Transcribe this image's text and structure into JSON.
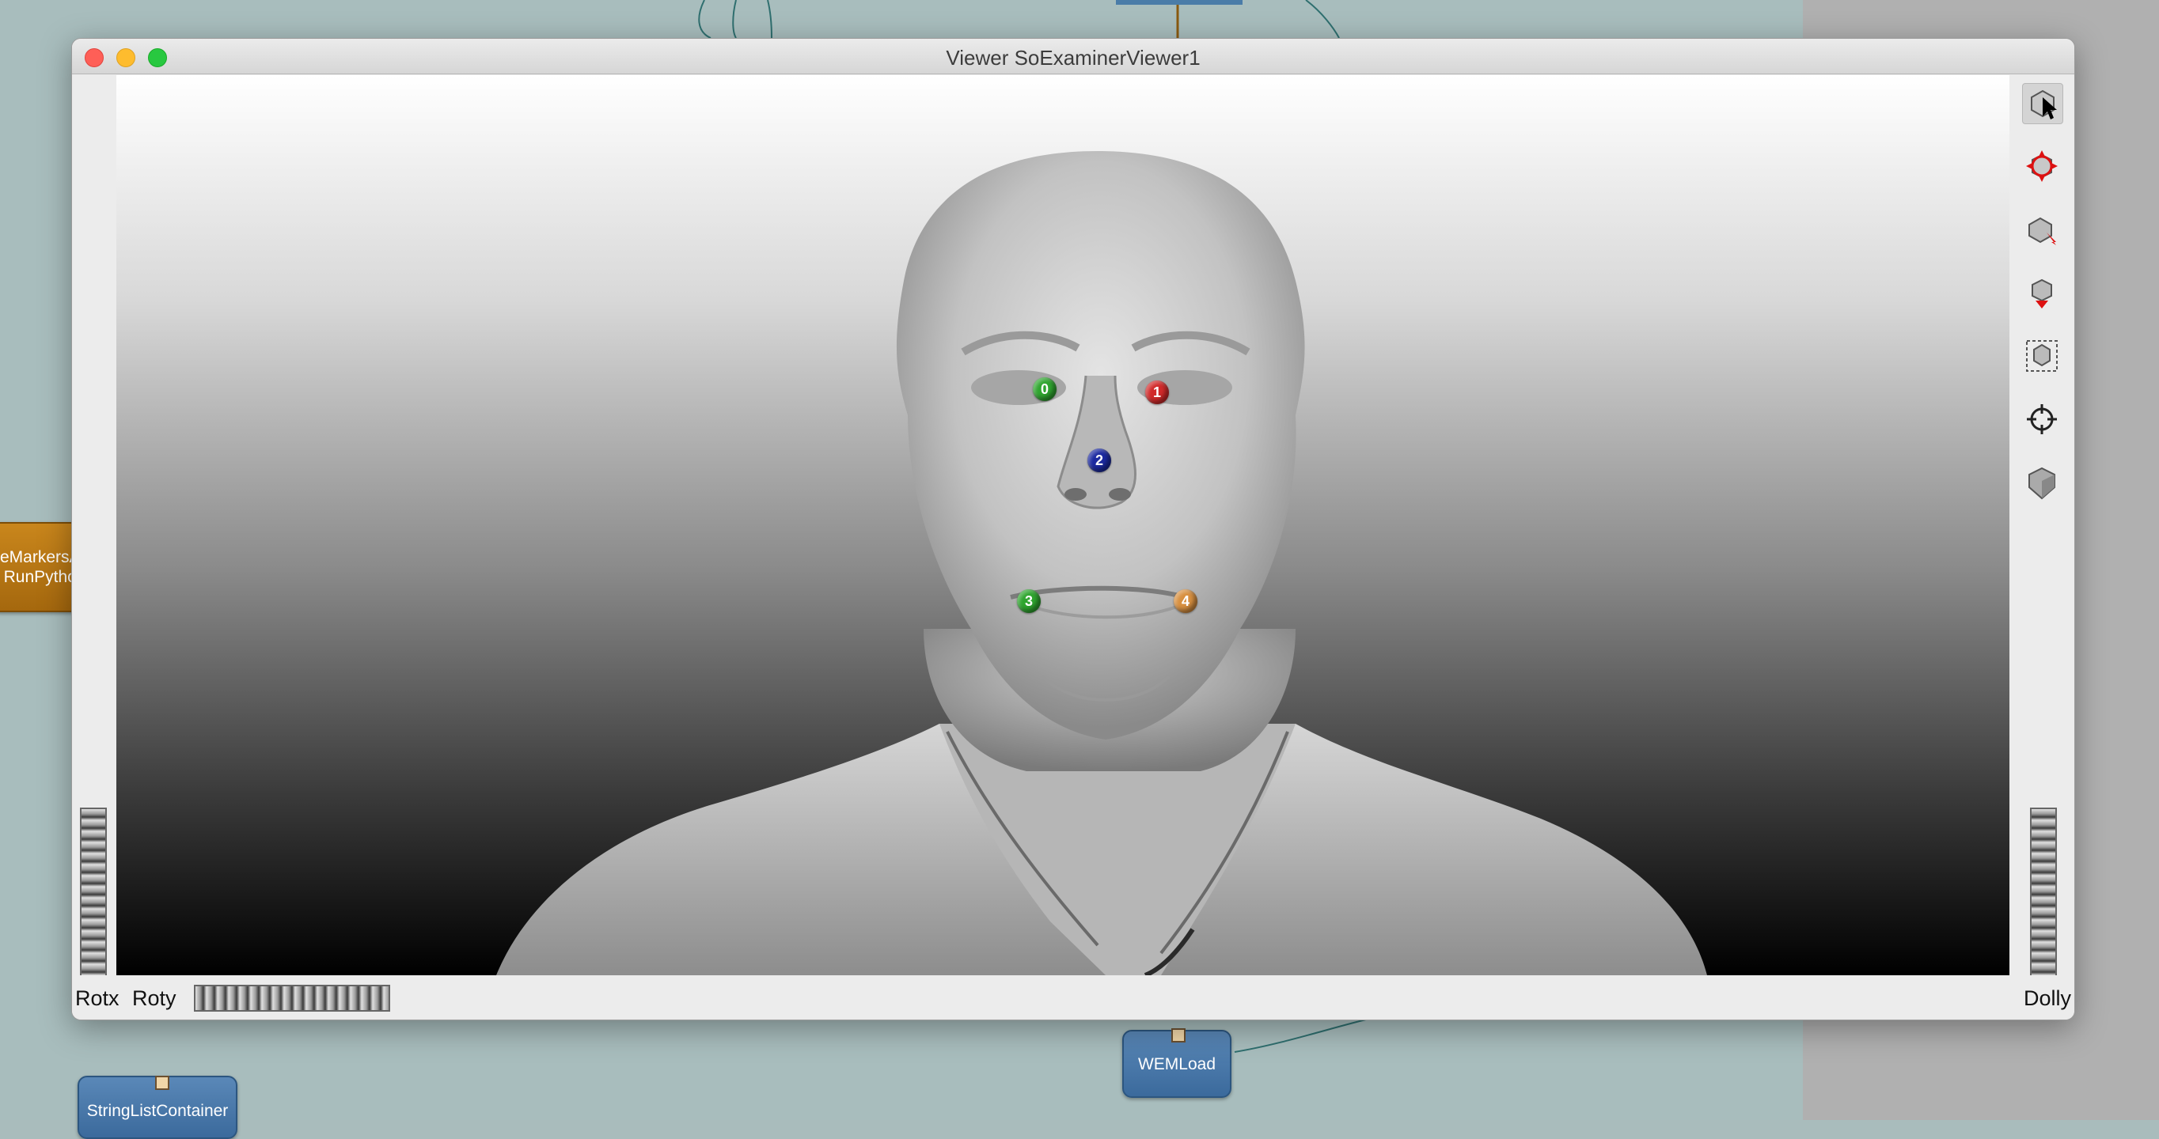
{
  "window": {
    "title": "Viewer SoExaminerViewer1"
  },
  "viewer": {
    "markers": [
      {
        "label": "0",
        "color": "#2fa52f"
      },
      {
        "label": "1",
        "color": "#d12a2a"
      },
      {
        "label": "2",
        "color": "#1c2aa0"
      },
      {
        "label": "3",
        "color": "#2fa52f"
      },
      {
        "label": "4",
        "color": "#d89040"
      }
    ],
    "thumbwheels": {
      "rotx": "Rotx",
      "roty": "Roty",
      "dolly": "Dolly"
    },
    "toolbar": [
      "pick-mode-icon",
      "view-mode-icon",
      "home-icon",
      "set-home-icon",
      "view-all-icon",
      "seek-icon",
      "projection-icon"
    ]
  },
  "network": {
    "modules": {
      "python": "eMarkersA\nRunPytho",
      "wemload": "WEMLoad",
      "stringlist": "StringListContainer"
    }
  }
}
